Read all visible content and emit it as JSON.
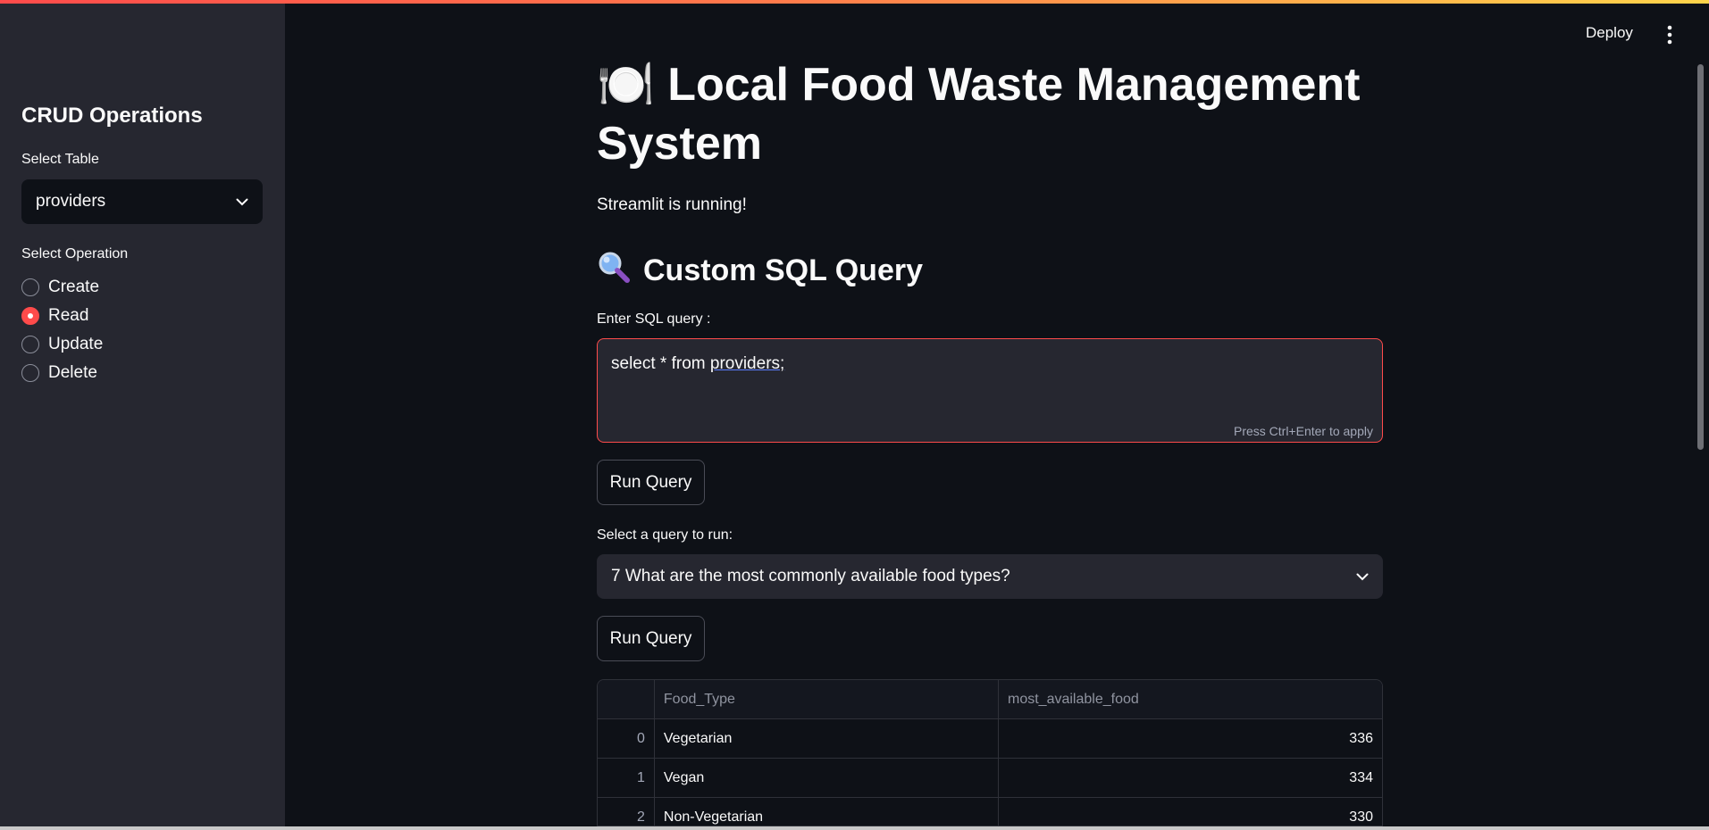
{
  "sidebar": {
    "title": "CRUD Operations",
    "select_table_label": "Select Table",
    "selected_table": "providers",
    "select_operation_label": "Select Operation",
    "operations": [
      {
        "label": "Create",
        "checked": false
      },
      {
        "label": "Read",
        "checked": true
      },
      {
        "label": "Update",
        "checked": false
      },
      {
        "label": "Delete",
        "checked": false
      }
    ]
  },
  "header": {
    "deploy_label": "Deploy",
    "menu_icon": "vertical-dots-icon"
  },
  "main": {
    "title": "🍽️ Local Food Waste Management System",
    "status_text": "Streamlit is running!",
    "section_heading": "Custom SQL Query",
    "section_icon": "magnifier-icon",
    "sql_label": "Enter SQL query :",
    "sql_value_prefix": "select * from ",
    "sql_value_word": "providers;",
    "sql_hint": "Press Ctrl+Enter to apply",
    "run_query_label": "Run Query",
    "query_select_label": "Select a query to run:",
    "query_selected": "7 What are the most commonly available food types?",
    "run_query_label_2": "Run Query"
  },
  "table": {
    "columns": [
      "",
      "Food_Type",
      "most_available_food"
    ],
    "rows": [
      {
        "idx": "0",
        "type": "Vegetarian",
        "value": "336"
      },
      {
        "idx": "1",
        "type": "Vegan",
        "value": "334"
      },
      {
        "idx": "2",
        "type": "Non-Vegetarian",
        "value": "330"
      }
    ]
  },
  "colors": {
    "accent": "#ff4b4b",
    "background": "#0e1117",
    "sidebar": "#262730"
  }
}
